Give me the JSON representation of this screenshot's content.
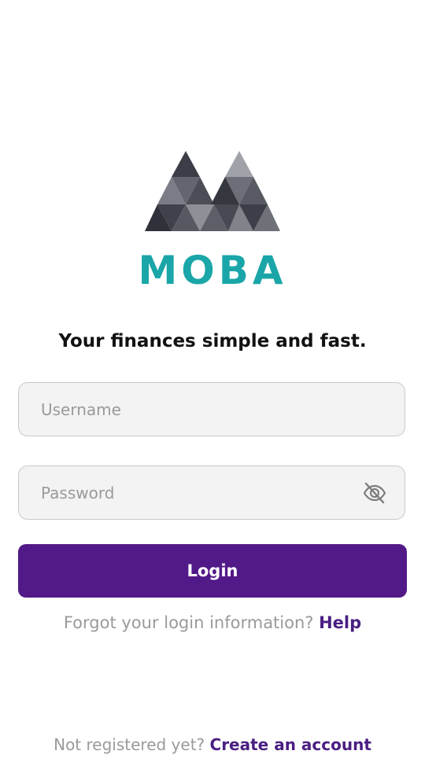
{
  "brand": {
    "name": "MOBA",
    "logo_icon": "moba-mountain-logo-icon",
    "name_color": "#1aa6a8"
  },
  "tagline": "Your finances simple and fast.",
  "login_form": {
    "username_placeholder": "Username",
    "username_value": "",
    "password_placeholder": "Password",
    "password_value": "",
    "password_toggle_icon": "eye-off-icon",
    "login_label": "Login",
    "login_button_color": "#521a88"
  },
  "forgot": {
    "text": "Forgot your login information?",
    "link_label": "Help"
  },
  "register": {
    "text": "Not registered yet?",
    "link_label": "Create an account"
  },
  "colors": {
    "link": "#4a1e82",
    "muted_text": "#9a9a9a",
    "field_bg": "#f3f3f3"
  }
}
